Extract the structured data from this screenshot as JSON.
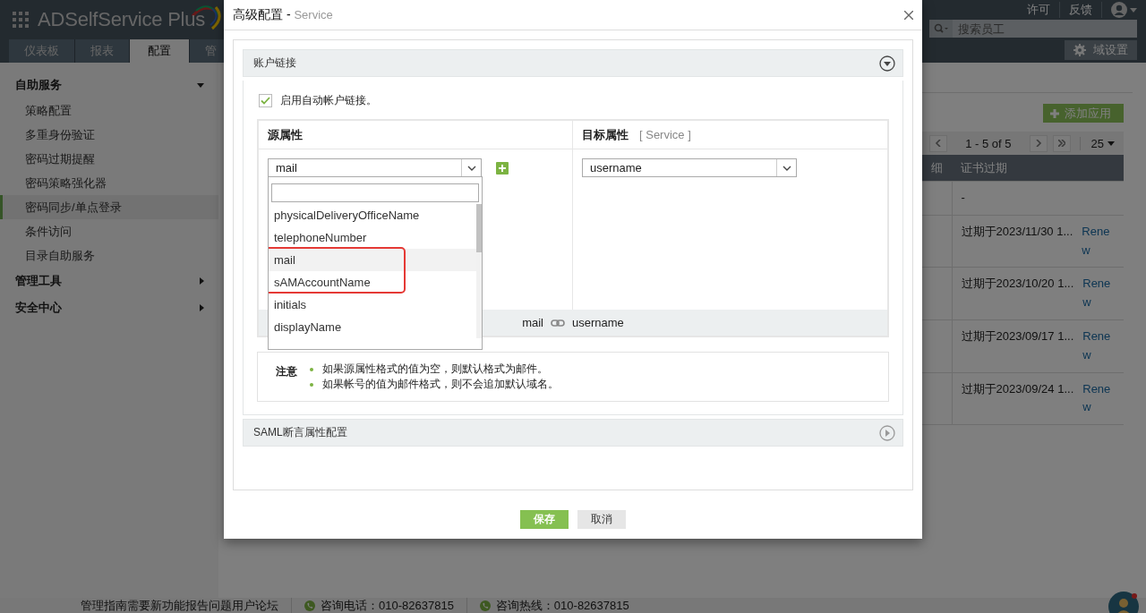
{
  "app": {
    "logo": "ADSelfService Plus",
    "tabs": [
      {
        "label": "仪表板",
        "selected": false
      },
      {
        "label": "报表",
        "selected": false
      },
      {
        "label": "配置",
        "selected": true
      },
      {
        "label": "管",
        "selected": false
      }
    ],
    "top_links": [
      "许可",
      "反馈"
    ],
    "search": {
      "placeholder": "搜索员工"
    },
    "domain_button": "域设置"
  },
  "sidebar": {
    "groups": [
      {
        "label": "自助服务",
        "expanded": true,
        "items": [
          {
            "label": "策略配置",
            "selected": false
          },
          {
            "label": "多重身份验证",
            "selected": false
          },
          {
            "label": "密码过期提醒",
            "selected": false
          },
          {
            "label": "密码策略强化器",
            "selected": false
          },
          {
            "label": "密码同步/单点登录",
            "selected": true
          },
          {
            "label": "条件访问",
            "selected": false
          },
          {
            "label": "目录自助服务",
            "selected": false
          }
        ]
      },
      {
        "label": "管理工具",
        "expanded": false
      },
      {
        "label": "安全中心",
        "expanded": false
      }
    ]
  },
  "main": {
    "add_button": "添加应用",
    "pager": {
      "range": "1 - 5 of 5",
      "page_size": "25"
    },
    "table": {
      "columns": [
        "细",
        "证书过期"
      ],
      "rows": [
        {
          "expiry": "-"
        },
        {
          "expiry": "过期于2023/11/30 1...",
          "action": "Renew"
        },
        {
          "expiry": "过期于2023/10/20 1...",
          "action": "Renew"
        },
        {
          "expiry": "过期于2023/09/17 1...",
          "action": "Renew"
        },
        {
          "expiry": "过期于2023/09/24 1...",
          "action": "Renew"
        }
      ]
    }
  },
  "footer": {
    "links": "管理指南需要新功能报告问题用户论坛",
    "phone": "咨询电话：010-82637815",
    "hotline": "咨询热线：010-82637815"
  },
  "dialog": {
    "title": "高级配置 -",
    "subtitle": "Service",
    "sections": [
      {
        "title": "账户链接",
        "expanded": true,
        "auto_link": {
          "label": "启用自动帐户链接。",
          "checked": true
        },
        "source_header": "源属性",
        "target_header": "目标属性",
        "target_app": "[ Service ]",
        "source_select": {
          "value": "mail",
          "open": true,
          "options": [
            {
              "label": "physicalDeliveryOfficeName",
              "selected": false,
              "marked": false
            },
            {
              "label": "telephoneNumber",
              "selected": false,
              "marked": false
            },
            {
              "label": "mail",
              "selected": true,
              "marked": true
            },
            {
              "label": "sAMAccountName",
              "selected": false,
              "marked": true
            },
            {
              "label": "initials",
              "selected": false,
              "marked": false
            },
            {
              "label": "displayName",
              "selected": false,
              "marked": false
            }
          ]
        },
        "target_select": {
          "value": "username"
        },
        "mapping": {
          "source": "mail",
          "target": "username"
        },
        "note_label": "注意",
        "notes": [
          "如果源属性格式的值为空，则默认格式为邮件。",
          "如果帐号的值为邮件格式，则不会追加默认域名。"
        ]
      },
      {
        "title": "SAML断言属性配置",
        "expanded": false
      }
    ],
    "buttons": [
      {
        "label": "保存",
        "kind": "primary"
      },
      {
        "label": "取消",
        "kind": "secondary"
      }
    ]
  }
}
